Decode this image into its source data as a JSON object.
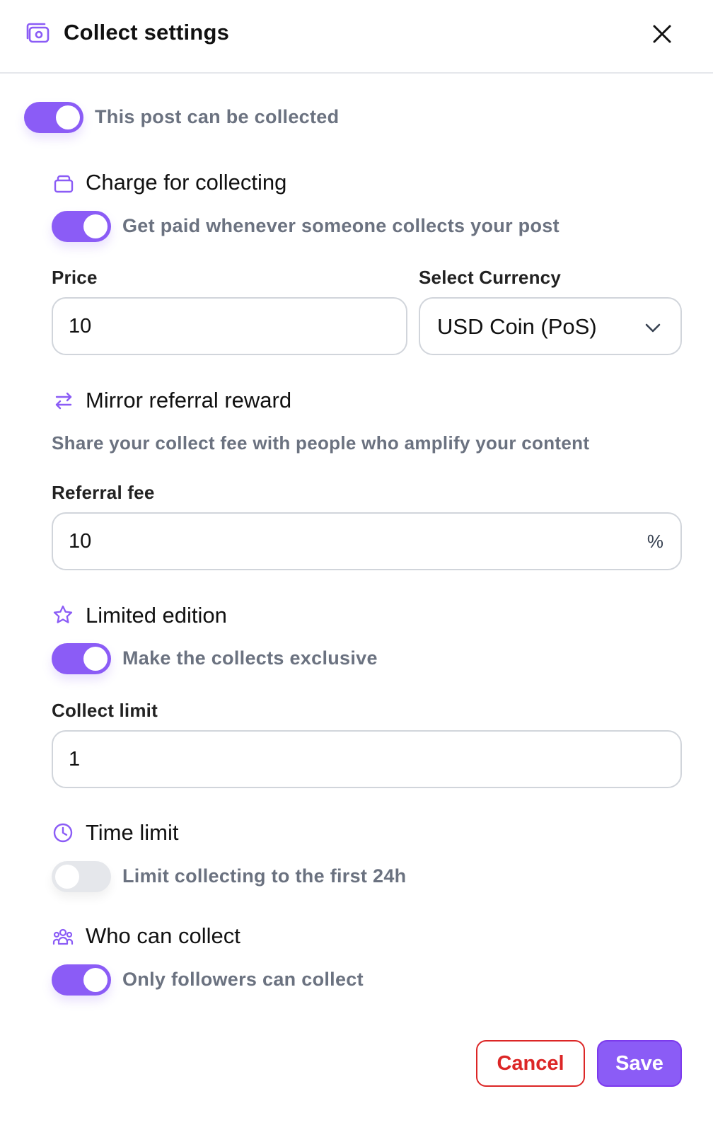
{
  "header": {
    "title": "Collect settings",
    "icon": "collect-icon",
    "close_icon": "close-icon"
  },
  "collectable": {
    "label": "This post can be collected",
    "enabled": true
  },
  "charge": {
    "title": "Charge for collecting",
    "icon": "lock-icon",
    "toggle_label": "Get paid whenever someone collects your post",
    "enabled": true,
    "price_label": "Price",
    "price_value": "10",
    "currency_label": "Select Currency",
    "currency_value": "USD Coin (PoS)"
  },
  "mirror": {
    "title": "Mirror referral reward",
    "icon": "switch-arrows-icon",
    "description": "Share your collect fee with people who amplify your content",
    "fee_label": "Referral fee",
    "fee_value": "10",
    "fee_suffix": "%"
  },
  "limited": {
    "title": "Limited edition",
    "icon": "star-icon",
    "toggle_label": "Make the collects exclusive",
    "enabled": true,
    "limit_label": "Collect limit",
    "limit_value": "1"
  },
  "time": {
    "title": "Time limit",
    "icon": "clock-icon",
    "toggle_label": "Limit collecting to the first 24h",
    "enabled": false
  },
  "who": {
    "title": "Who can collect",
    "icon": "users-icon",
    "toggle_label": "Only followers can collect",
    "enabled": true
  },
  "actions": {
    "cancel_label": "Cancel",
    "save_label": "Save"
  },
  "colors": {
    "accent": "#8B5CF6",
    "danger": "#DC2626",
    "muted_text": "#6B7280",
    "border": "#D1D5DB"
  }
}
